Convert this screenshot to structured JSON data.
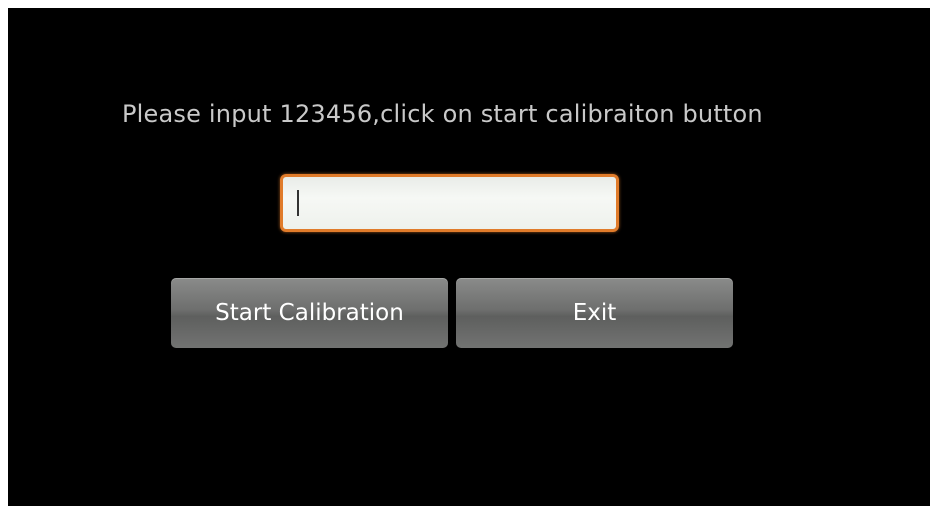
{
  "prompt": {
    "text": "Please input 123456,click on start calibraiton button"
  },
  "input": {
    "value": "",
    "placeholder": ""
  },
  "buttons": {
    "start_label": "Start Calibration",
    "exit_label": "Exit"
  },
  "colors": {
    "background": "#000000",
    "prompt_text": "#c9c9c9",
    "input_focus_border": "#e07b2a",
    "button_gray": "#6e6f6e"
  }
}
